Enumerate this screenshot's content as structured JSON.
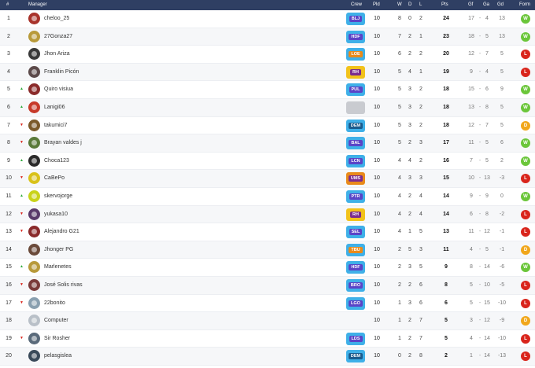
{
  "header": {
    "pos": "#",
    "manager": "Manager",
    "crew": "Crew",
    "pld": "Pld",
    "w": "W",
    "d": "D",
    "l": "L",
    "pts": "Pts",
    "gf": "Gf",
    "ga": "Ga",
    "gd": "Gd",
    "form": "Form"
  },
  "colors": {
    "header_bg": "#2f3f63",
    "form_w": "#6bc63a",
    "form_l": "#d9251c",
    "form_d": "#f1a71b",
    "trend_up": "#2eaa3b",
    "trend_down": "#d9251c"
  },
  "rows": [
    {
      "pos": "1",
      "trend": "",
      "trend_icon": "",
      "manager": "cheloo_25",
      "crew": "BLJ",
      "crew_color": "#5a44c7",
      "crew_border": "#3fb0e8",
      "pld": "10",
      "w": "8",
      "d": "0",
      "l": "2",
      "pts": "24",
      "gf": "17",
      "dash": "-",
      "ga": "4",
      "gd": "13",
      "form": "W",
      "form_color": "#6bc63a"
    },
    {
      "pos": "2",
      "trend": "",
      "trend_icon": "",
      "manager": "27Gonza27",
      "crew": "HDF",
      "crew_color": "#5a44c7",
      "crew_border": "#3fb0e8",
      "pld": "10",
      "w": "7",
      "d": "2",
      "l": "1",
      "pts": "23",
      "gf": "18",
      "dash": "-",
      "ga": "5",
      "gd": "13",
      "form": "W",
      "form_color": "#6bc63a"
    },
    {
      "pos": "3",
      "trend": "",
      "trend_icon": "",
      "manager": "Jhon Ariza",
      "crew": "LOE",
      "crew_color": "#e98a1a",
      "crew_border": "#3fb0e8",
      "pld": "10",
      "w": "6",
      "d": "2",
      "l": "2",
      "pts": "20",
      "gf": "12",
      "dash": "-",
      "ga": "7",
      "gd": "5",
      "form": "L",
      "form_color": "#d9251c"
    },
    {
      "pos": "4",
      "trend": "",
      "trend_icon": "",
      "manager": "Franklin Picón",
      "crew": "RH",
      "crew_color": "#7c2c8e",
      "crew_border": "#f2c21b",
      "pld": "10",
      "w": "5",
      "d": "4",
      "l": "1",
      "pts": "19",
      "gf": "9",
      "dash": "-",
      "ga": "4",
      "gd": "5",
      "form": "L",
      "form_color": "#d9251c"
    },
    {
      "pos": "5",
      "trend": "up",
      "trend_icon": "▲",
      "manager": "Quiro visiua",
      "crew": "PUL",
      "crew_color": "#5a44c7",
      "crew_border": "#3fb0e8",
      "pld": "10",
      "w": "5",
      "d": "3",
      "l": "2",
      "pts": "18",
      "gf": "15",
      "dash": "-",
      "ga": "6",
      "gd": "9",
      "form": "W",
      "form_color": "#6bc63a"
    },
    {
      "pos": "6",
      "trend": "up",
      "trend_icon": "▲",
      "manager": "Lanigi06",
      "crew": "",
      "crew_color": "#c9cbd0",
      "crew_border": "#c9cbd0",
      "pld": "10",
      "w": "5",
      "d": "3",
      "l": "2",
      "pts": "18",
      "gf": "13",
      "dash": "-",
      "ga": "8",
      "gd": "5",
      "form": "W",
      "form_color": "#6bc63a"
    },
    {
      "pos": "7",
      "trend": "down",
      "trend_icon": "▼",
      "manager": "takumici7",
      "crew": "DEM",
      "crew_color": "#1b5c8e",
      "crew_border": "#3fb0e8",
      "pld": "10",
      "w": "5",
      "d": "3",
      "l": "2",
      "pts": "18",
      "gf": "12",
      "dash": "-",
      "ga": "7",
      "gd": "5",
      "form": "D",
      "form_color": "#f1a71b"
    },
    {
      "pos": "8",
      "trend": "down",
      "trend_icon": "▼",
      "manager": "Brayan valdes j",
      "crew": "BAL",
      "crew_color": "#5a44c7",
      "crew_border": "#3fb0e8",
      "pld": "10",
      "w": "5",
      "d": "2",
      "l": "3",
      "pts": "17",
      "gf": "11",
      "dash": "-",
      "ga": "5",
      "gd": "6",
      "form": "W",
      "form_color": "#6bc63a"
    },
    {
      "pos": "9",
      "trend": "up",
      "trend_icon": "▲",
      "manager": "Choca123",
      "crew": "LCN",
      "crew_color": "#5a44c7",
      "crew_border": "#3fb0e8",
      "pld": "10",
      "w": "4",
      "d": "4",
      "l": "2",
      "pts": "16",
      "gf": "7",
      "dash": "-",
      "ga": "5",
      "gd": "2",
      "form": "W",
      "form_color": "#6bc63a"
    },
    {
      "pos": "10",
      "trend": "down",
      "trend_icon": "▼",
      "manager": "CaBePo",
      "crew": "UMS",
      "crew_color": "#7c2c8e",
      "crew_border": "#e98a1a",
      "pld": "10",
      "w": "4",
      "d": "3",
      "l": "3",
      "pts": "15",
      "gf": "10",
      "dash": "-",
      "ga": "13",
      "gd": "-3",
      "form": "L",
      "form_color": "#d9251c"
    },
    {
      "pos": "11",
      "trend": "up",
      "trend_icon": "▲",
      "manager": "skervojorge",
      "crew": "PTR",
      "crew_color": "#5a44c7",
      "crew_border": "#3fb0e8",
      "pld": "10",
      "w": "4",
      "d": "2",
      "l": "4",
      "pts": "14",
      "gf": "9",
      "dash": "-",
      "ga": "9",
      "gd": "0",
      "form": "W",
      "form_color": "#6bc63a"
    },
    {
      "pos": "12",
      "trend": "down",
      "trend_icon": "▼",
      "manager": "yukasa10",
      "crew": "RH",
      "crew_color": "#7c2c8e",
      "crew_border": "#f2c21b",
      "pld": "10",
      "w": "4",
      "d": "2",
      "l": "4",
      "pts": "14",
      "gf": "6",
      "dash": "-",
      "ga": "8",
      "gd": "-2",
      "form": "L",
      "form_color": "#d9251c"
    },
    {
      "pos": "13",
      "trend": "down",
      "trend_icon": "▼",
      "manager": "Alejandro G21",
      "crew": "SEL",
      "crew_color": "#5a44c7",
      "crew_border": "#3fb0e8",
      "pld": "10",
      "w": "4",
      "d": "1",
      "l": "5",
      "pts": "13",
      "gf": "11",
      "dash": "-",
      "ga": "12",
      "gd": "-1",
      "form": "L",
      "form_color": "#d9251c"
    },
    {
      "pos": "14",
      "trend": "",
      "trend_icon": "",
      "manager": "Jhonger PG",
      "crew": "TBU",
      "crew_color": "#e98a1a",
      "crew_border": "#3fb0e8",
      "pld": "10",
      "w": "2",
      "d": "5",
      "l": "3",
      "pts": "11",
      "gf": "4",
      "dash": "-",
      "ga": "5",
      "gd": "-1",
      "form": "D",
      "form_color": "#f1a71b"
    },
    {
      "pos": "15",
      "trend": "up",
      "trend_icon": "▲",
      "manager": "Marlenetes",
      "crew": "HDF",
      "crew_color": "#5a44c7",
      "crew_border": "#3fb0e8",
      "pld": "10",
      "w": "2",
      "d": "3",
      "l": "5",
      "pts": "9",
      "gf": "8",
      "dash": "-",
      "ga": "14",
      "gd": "-6",
      "form": "W",
      "form_color": "#6bc63a"
    },
    {
      "pos": "16",
      "trend": "down",
      "trend_icon": "▼",
      "manager": "José Solis rivas",
      "crew": "BRO",
      "crew_color": "#5a44c7",
      "crew_border": "#3fb0e8",
      "pld": "10",
      "w": "2",
      "d": "2",
      "l": "6",
      "pts": "8",
      "gf": "5",
      "dash": "-",
      "ga": "10",
      "gd": "-5",
      "form": "L",
      "form_color": "#d9251c"
    },
    {
      "pos": "17",
      "trend": "down",
      "trend_icon": "▼",
      "manager": "22bonito",
      "crew": "LGO",
      "crew_color": "#5a44c7",
      "crew_border": "#3fb0e8",
      "pld": "10",
      "w": "1",
      "d": "3",
      "l": "6",
      "pts": "6",
      "gf": "5",
      "dash": "-",
      "ga": "15",
      "gd": "-10",
      "form": "L",
      "form_color": "#d9251c"
    },
    {
      "pos": "18",
      "trend": "",
      "trend_icon": "",
      "manager": "Computer",
      "crew": "",
      "crew_color": "",
      "crew_border": "",
      "pld": "10",
      "w": "1",
      "d": "2",
      "l": "7",
      "pts": "5",
      "gf": "3",
      "dash": "-",
      "ga": "12",
      "gd": "-9",
      "form": "D",
      "form_color": "#f1a71b"
    },
    {
      "pos": "19",
      "trend": "down",
      "trend_icon": "▼",
      "manager": "Sir Rosher",
      "crew": "LDS",
      "crew_color": "#5a44c7",
      "crew_border": "#3fb0e8",
      "pld": "10",
      "w": "1",
      "d": "2",
      "l": "7",
      "pts": "5",
      "gf": "4",
      "dash": "-",
      "ga": "14",
      "gd": "-10",
      "form": "L",
      "form_color": "#d9251c"
    },
    {
      "pos": "20",
      "trend": "",
      "trend_icon": "",
      "manager": "pelasgislea",
      "crew": "DEM",
      "crew_color": "#1b5c8e",
      "crew_border": "#3fb0e8",
      "pld": "10",
      "w": "0",
      "d": "2",
      "l": "8",
      "pts": "2",
      "gf": "1",
      "dash": "-",
      "ga": "14",
      "gd": "-13",
      "form": "L",
      "form_color": "#d9251c"
    }
  ]
}
